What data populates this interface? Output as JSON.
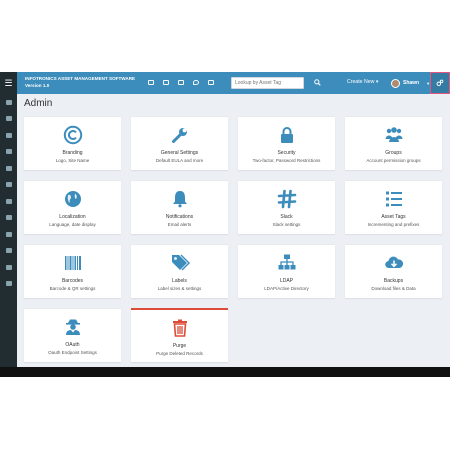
{
  "header": {
    "app_title": "INFOTRONICS ASSET MANAGEMENT SOFTWARE Version 1.0",
    "search_placeholder": "Lookup by Asset Tag",
    "create_new": "Create New",
    "user_name": "Shawn"
  },
  "topbar_icons": [
    "barcode-icon",
    "keyboard-icon",
    "hdd-icon",
    "tint-icon",
    "print-icon"
  ],
  "sidebar": {
    "icons": [
      "dashboard-icon",
      "barcode-icon",
      "keyboard-icon",
      "hdd-icon",
      "database-icon",
      "tint-icon",
      "print-icon",
      "user-icon",
      "cloud-download-icon",
      "settings-icon",
      "chart-icon",
      "laptop-icon"
    ]
  },
  "page": {
    "title": "Admin"
  },
  "cards": [
    {
      "title": "Branding",
      "subtitle": "Logo, Site Name",
      "icon": "copyright-icon"
    },
    {
      "title": "General Settings",
      "subtitle": "Default EULA and more",
      "icon": "wrench-icon"
    },
    {
      "title": "Security",
      "subtitle": "Two-factor, Password Restrictions",
      "icon": "lock-icon"
    },
    {
      "title": "Groups",
      "subtitle": "Account permission groups",
      "icon": "groups-icon"
    },
    {
      "title": "Localization",
      "subtitle": "Language, date display",
      "icon": "globe-icon"
    },
    {
      "title": "Notifications",
      "subtitle": "Email alerts",
      "icon": "bell-icon"
    },
    {
      "title": "Slack",
      "subtitle": "Slack settings",
      "icon": "slack-icon"
    },
    {
      "title": "Asset Tags",
      "subtitle": "Incrementing and prefixes",
      "icon": "list-icon"
    },
    {
      "title": "Barcodes",
      "subtitle": "Barcode & QR settings",
      "icon": "barcode-icon"
    },
    {
      "title": "Labels",
      "subtitle": "Label sizes & settings",
      "icon": "tags-icon"
    },
    {
      "title": "LDAP",
      "subtitle": "LDAP/Active Directory",
      "icon": "sitemap-icon"
    },
    {
      "title": "Backups",
      "subtitle": "Download files & Data",
      "icon": "cloud-download-icon"
    },
    {
      "title": "OAuth",
      "subtitle": "Oauth Endpoint Settings",
      "icon": "user-secret-icon"
    },
    {
      "title": "Purge",
      "subtitle": "Purge Deleted Records",
      "icon": "trash-icon",
      "active": true
    }
  ],
  "colors": {
    "topbar": "#3c8dbc",
    "sidebar": "#222d32",
    "icon": "#3c8dbc",
    "purge_icon": "#dd4b39",
    "content_bg": "#ecf0f5"
  }
}
